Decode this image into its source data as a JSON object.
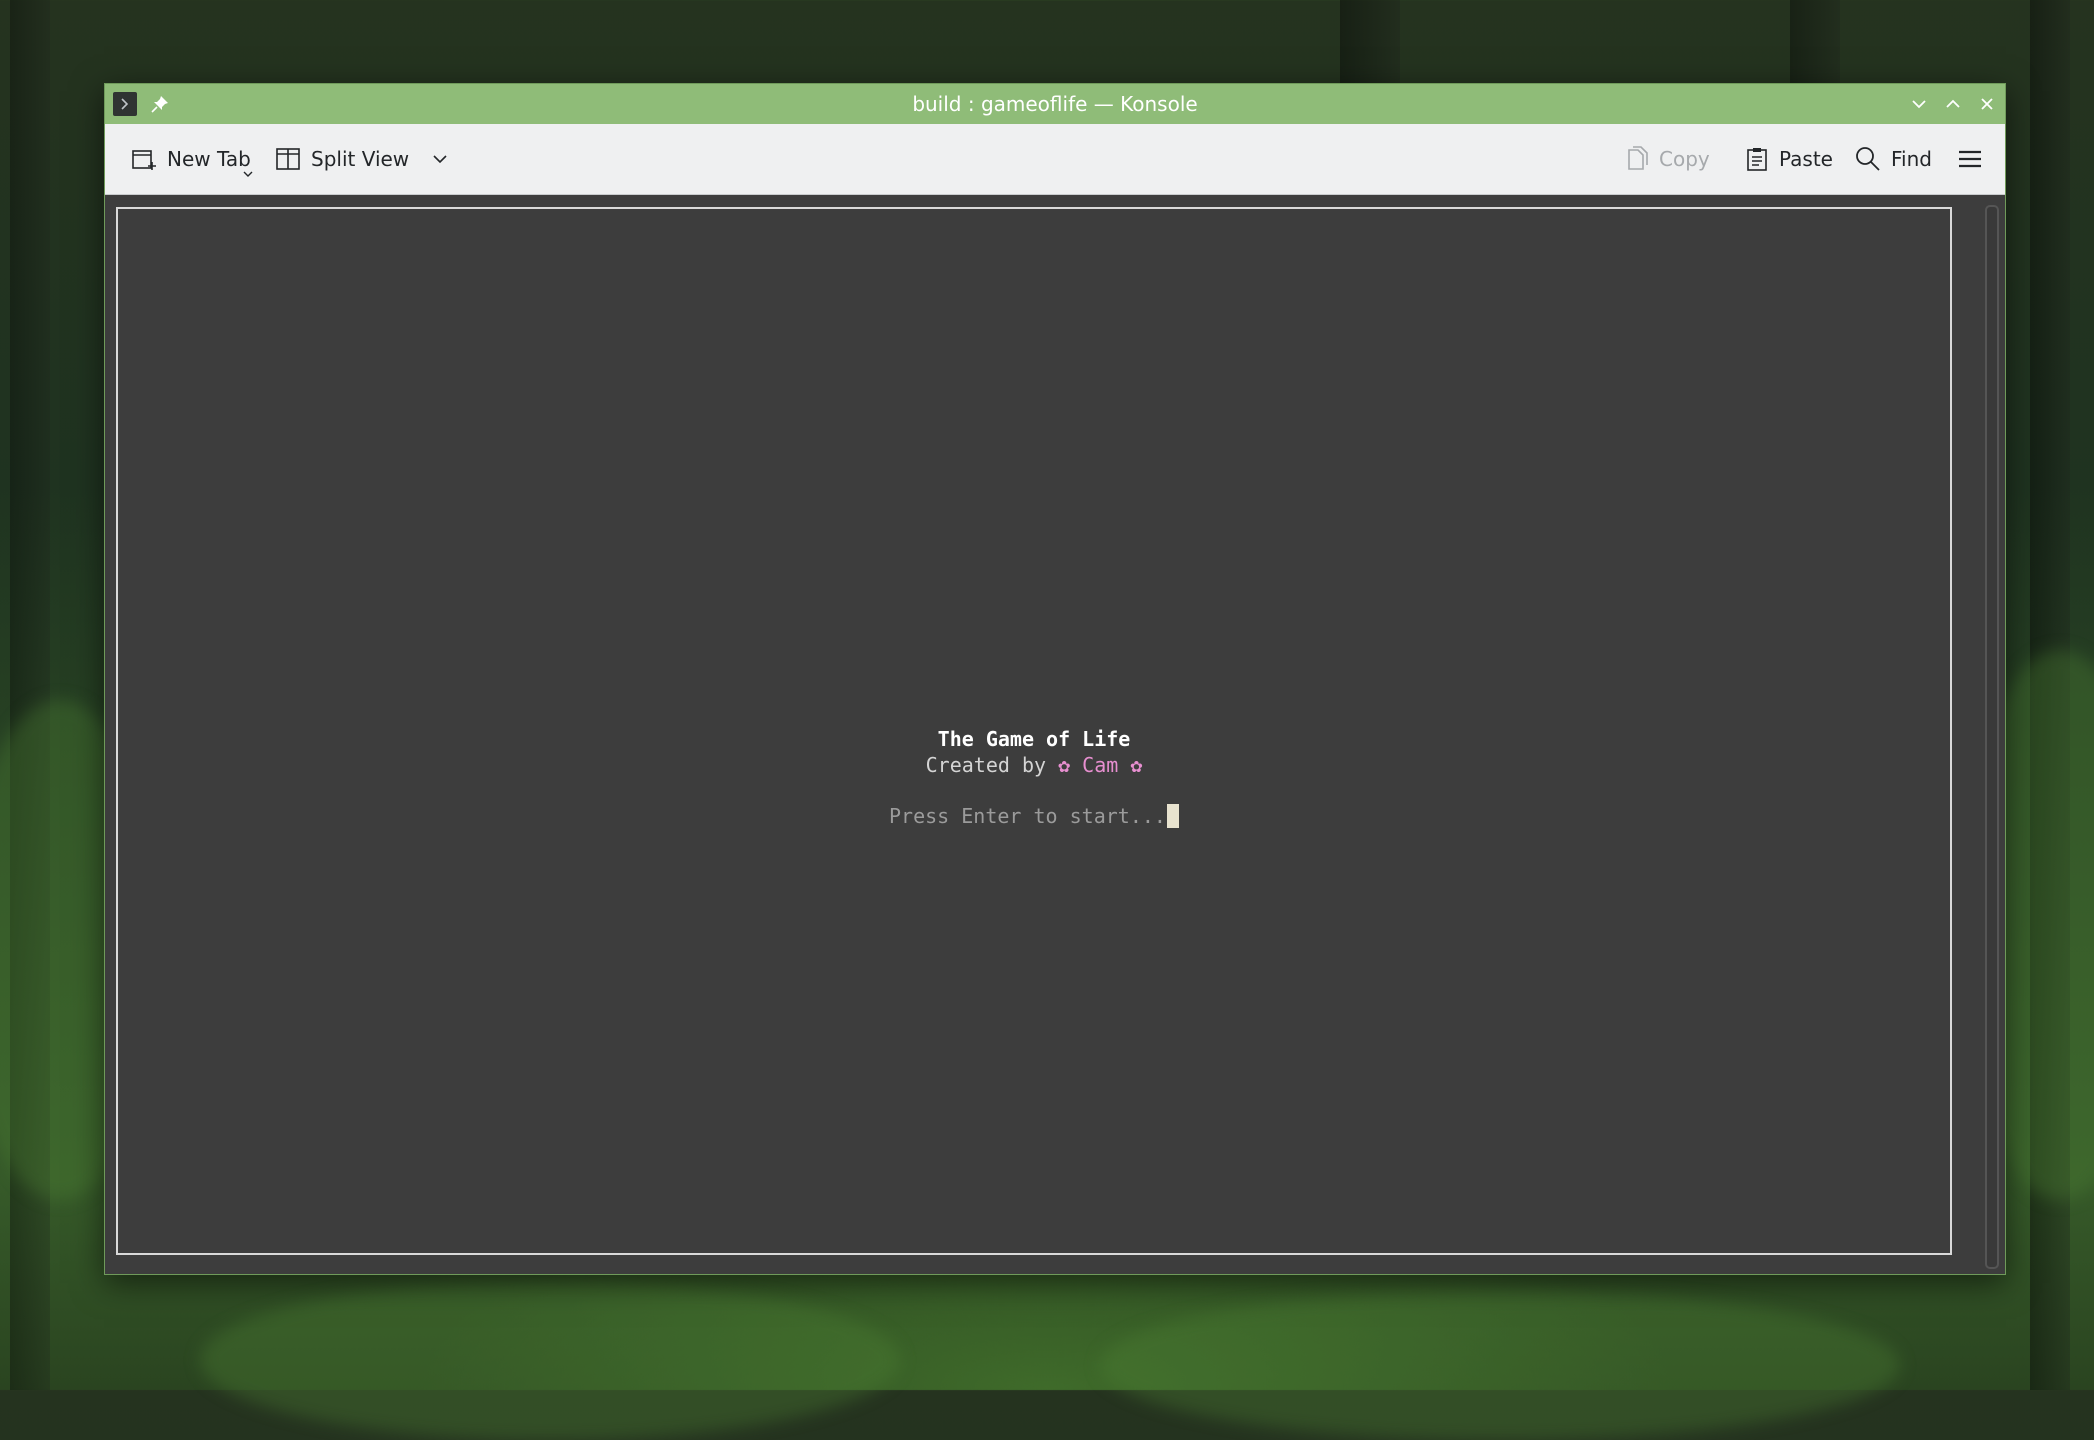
{
  "window": {
    "title": "build : gameoflife — Konsole",
    "titlebar_color": "#8fbc78",
    "app_icon": "terminal-icon",
    "pin_icon": "pin-icon",
    "controls": [
      "minimize-icon",
      "maximize-icon",
      "close-icon"
    ]
  },
  "toolbar": {
    "new_tab": "New Tab",
    "split_view": "Split View",
    "copy": "Copy",
    "paste": "Paste",
    "find": "Find",
    "menu_icon": "hamburger-menu-icon"
  },
  "terminal": {
    "background": "#3d3d3d",
    "title_line": "The Game of Life",
    "created_prefix": "Created by ",
    "created_name": "✿ Cam ✿",
    "prompt": "Press Enter to start...",
    "accent_pink": "#e78fd0"
  }
}
